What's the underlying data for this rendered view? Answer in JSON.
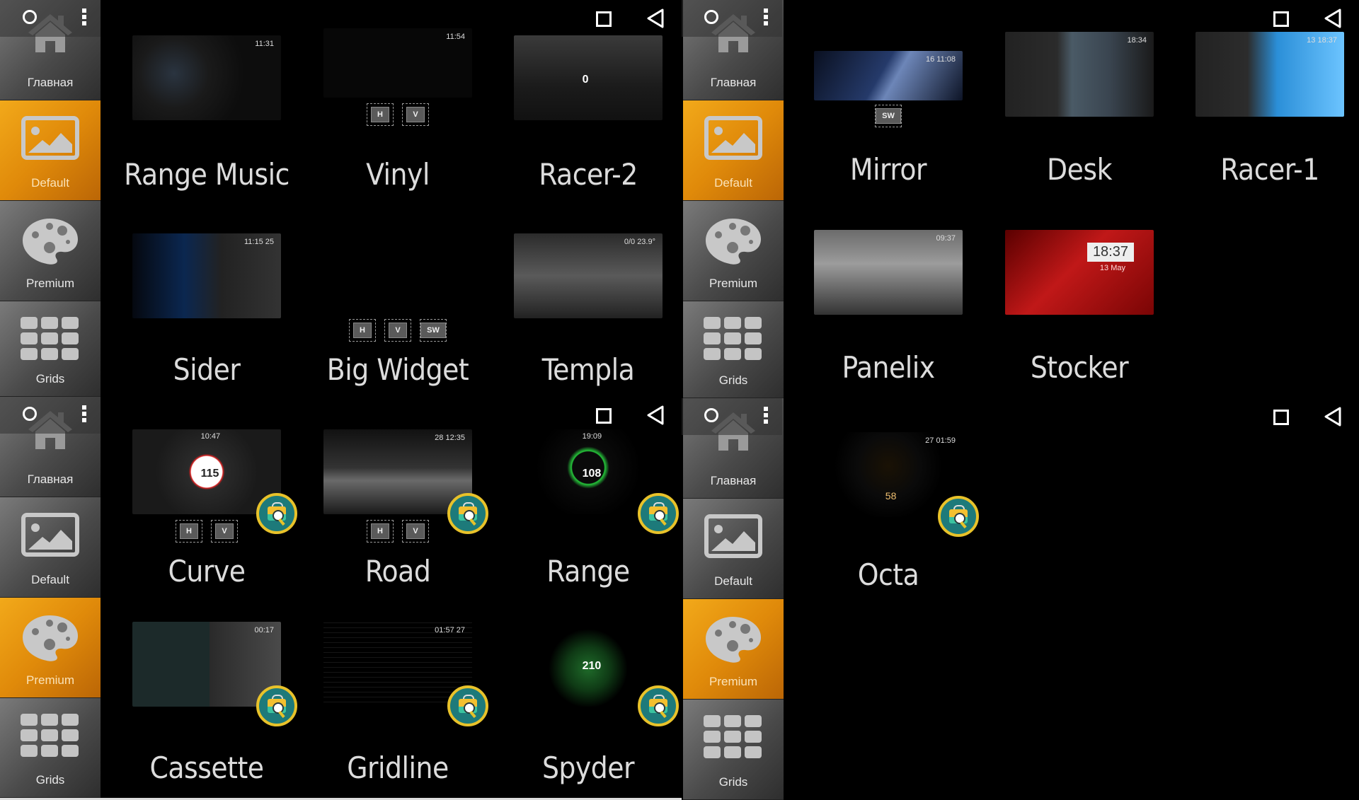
{
  "sidebar": {
    "items": [
      {
        "label": "Главная",
        "icon": "home-icon"
      },
      {
        "label": "Default",
        "icon": "image-icon"
      },
      {
        "label": "Premium",
        "icon": "palette-icon"
      },
      {
        "label": "Grids",
        "icon": "grid-icon"
      }
    ]
  },
  "screens": [
    {
      "active_tab": "Default",
      "themes": [
        {
          "title": "Range Music",
          "thumb_text": "11:31",
          "orientations": [],
          "premium": false
        },
        {
          "title": "Vinyl",
          "thumb_text": "11:54",
          "orientations": [
            "H",
            "V"
          ],
          "premium": false
        },
        {
          "title": "Racer-2",
          "thumb_text": "0",
          "orientations": [],
          "premium": false
        },
        {
          "title": "Sider",
          "thumb_text": "11:15  25",
          "orientations": [],
          "premium": false
        },
        {
          "title": "Big Widget",
          "thumb_text": "",
          "orientations": [
            "H",
            "V",
            "SW"
          ],
          "premium": false
        },
        {
          "title": "Templa",
          "thumb_text": "0/0  23.9°",
          "orientations": [],
          "premium": false
        }
      ]
    },
    {
      "active_tab": "Default",
      "themes": [
        {
          "title": "Mirror",
          "thumb_text": "16   11:08",
          "orientations": [
            "SW"
          ],
          "premium": false
        },
        {
          "title": "Desk",
          "thumb_text": "18:34",
          "orientations": [],
          "premium": false
        },
        {
          "title": "Racer-1",
          "thumb_text": "13   18:37",
          "orientations": [],
          "premium": false
        },
        {
          "title": "Panelix",
          "thumb_text": "09:37",
          "orientations": [],
          "premium": false
        },
        {
          "title": "Stocker",
          "thumb_text": "18:37",
          "thumb_subtext": "13 May",
          "orientations": [],
          "premium": false
        }
      ]
    },
    {
      "active_tab": "Premium",
      "themes": [
        {
          "title": "Curve",
          "thumb_text": "115",
          "thumb_time": "10:47",
          "orientations": [
            "H",
            "V"
          ],
          "premium": true
        },
        {
          "title": "Road",
          "thumb_text": "28   12:35",
          "orientations": [
            "H",
            "V"
          ],
          "premium": true
        },
        {
          "title": "Range",
          "thumb_text": "108",
          "thumb_time": "19:09",
          "orientations": [],
          "premium": true
        },
        {
          "title": "Cassette",
          "thumb_text": "00:17",
          "orientations": [],
          "premium": true
        },
        {
          "title": "Gridline",
          "thumb_text": "01:57  27",
          "orientations": [],
          "premium": true
        },
        {
          "title": "Spyder",
          "thumb_text": "210",
          "orientations": [],
          "premium": true
        }
      ]
    },
    {
      "active_tab": "Premium",
      "themes": [
        {
          "title": "Octa",
          "thumb_text": "27        01:59",
          "thumb_subtext": "58",
          "orientations": [],
          "premium": true
        }
      ]
    }
  ],
  "system": {
    "home_button": "circle-home",
    "menu_button": "overflow-menu",
    "recents_button": "square-recents",
    "back_button": "triangle-back"
  },
  "colors": {
    "active_tab": "#e8960e",
    "sidebar": "#555555",
    "title_text": "#dcdcdc",
    "premium_badge_ring": "#e8c22a",
    "premium_badge_fill": "#1d7a7a"
  }
}
